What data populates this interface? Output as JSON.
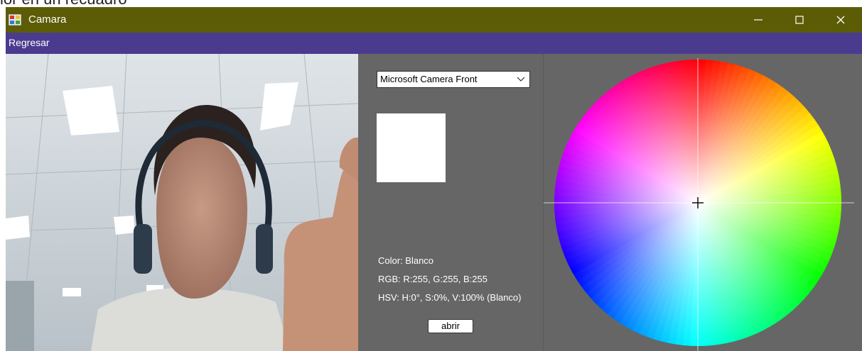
{
  "background_caption": "lor en un recuadro",
  "window": {
    "title": "Camara",
    "minimize_glyph": "—",
    "maximize_glyph": "☐",
    "close_glyph": "✕",
    "titlebar_color": "#5c5c06",
    "menubar_color": "#4b3b8f",
    "panel_color": "#666666"
  },
  "menu": {
    "back_label": "Regresar"
  },
  "controls": {
    "camera_select_value": "Microsoft Camera Front",
    "selected_color_hex": "#ffffff",
    "color_text": "Color: Blanco",
    "rgb_text": "RGB: R:255, G:255, B:255",
    "hsv_text": "HSV: H:0°, S:0%, V:100% (Blanco)",
    "open_button_label": "abrir"
  },
  "icons": {
    "app": "camera-app-icon",
    "dropdown": "chevron-down-icon",
    "crosshair": "crosshair-icon"
  }
}
